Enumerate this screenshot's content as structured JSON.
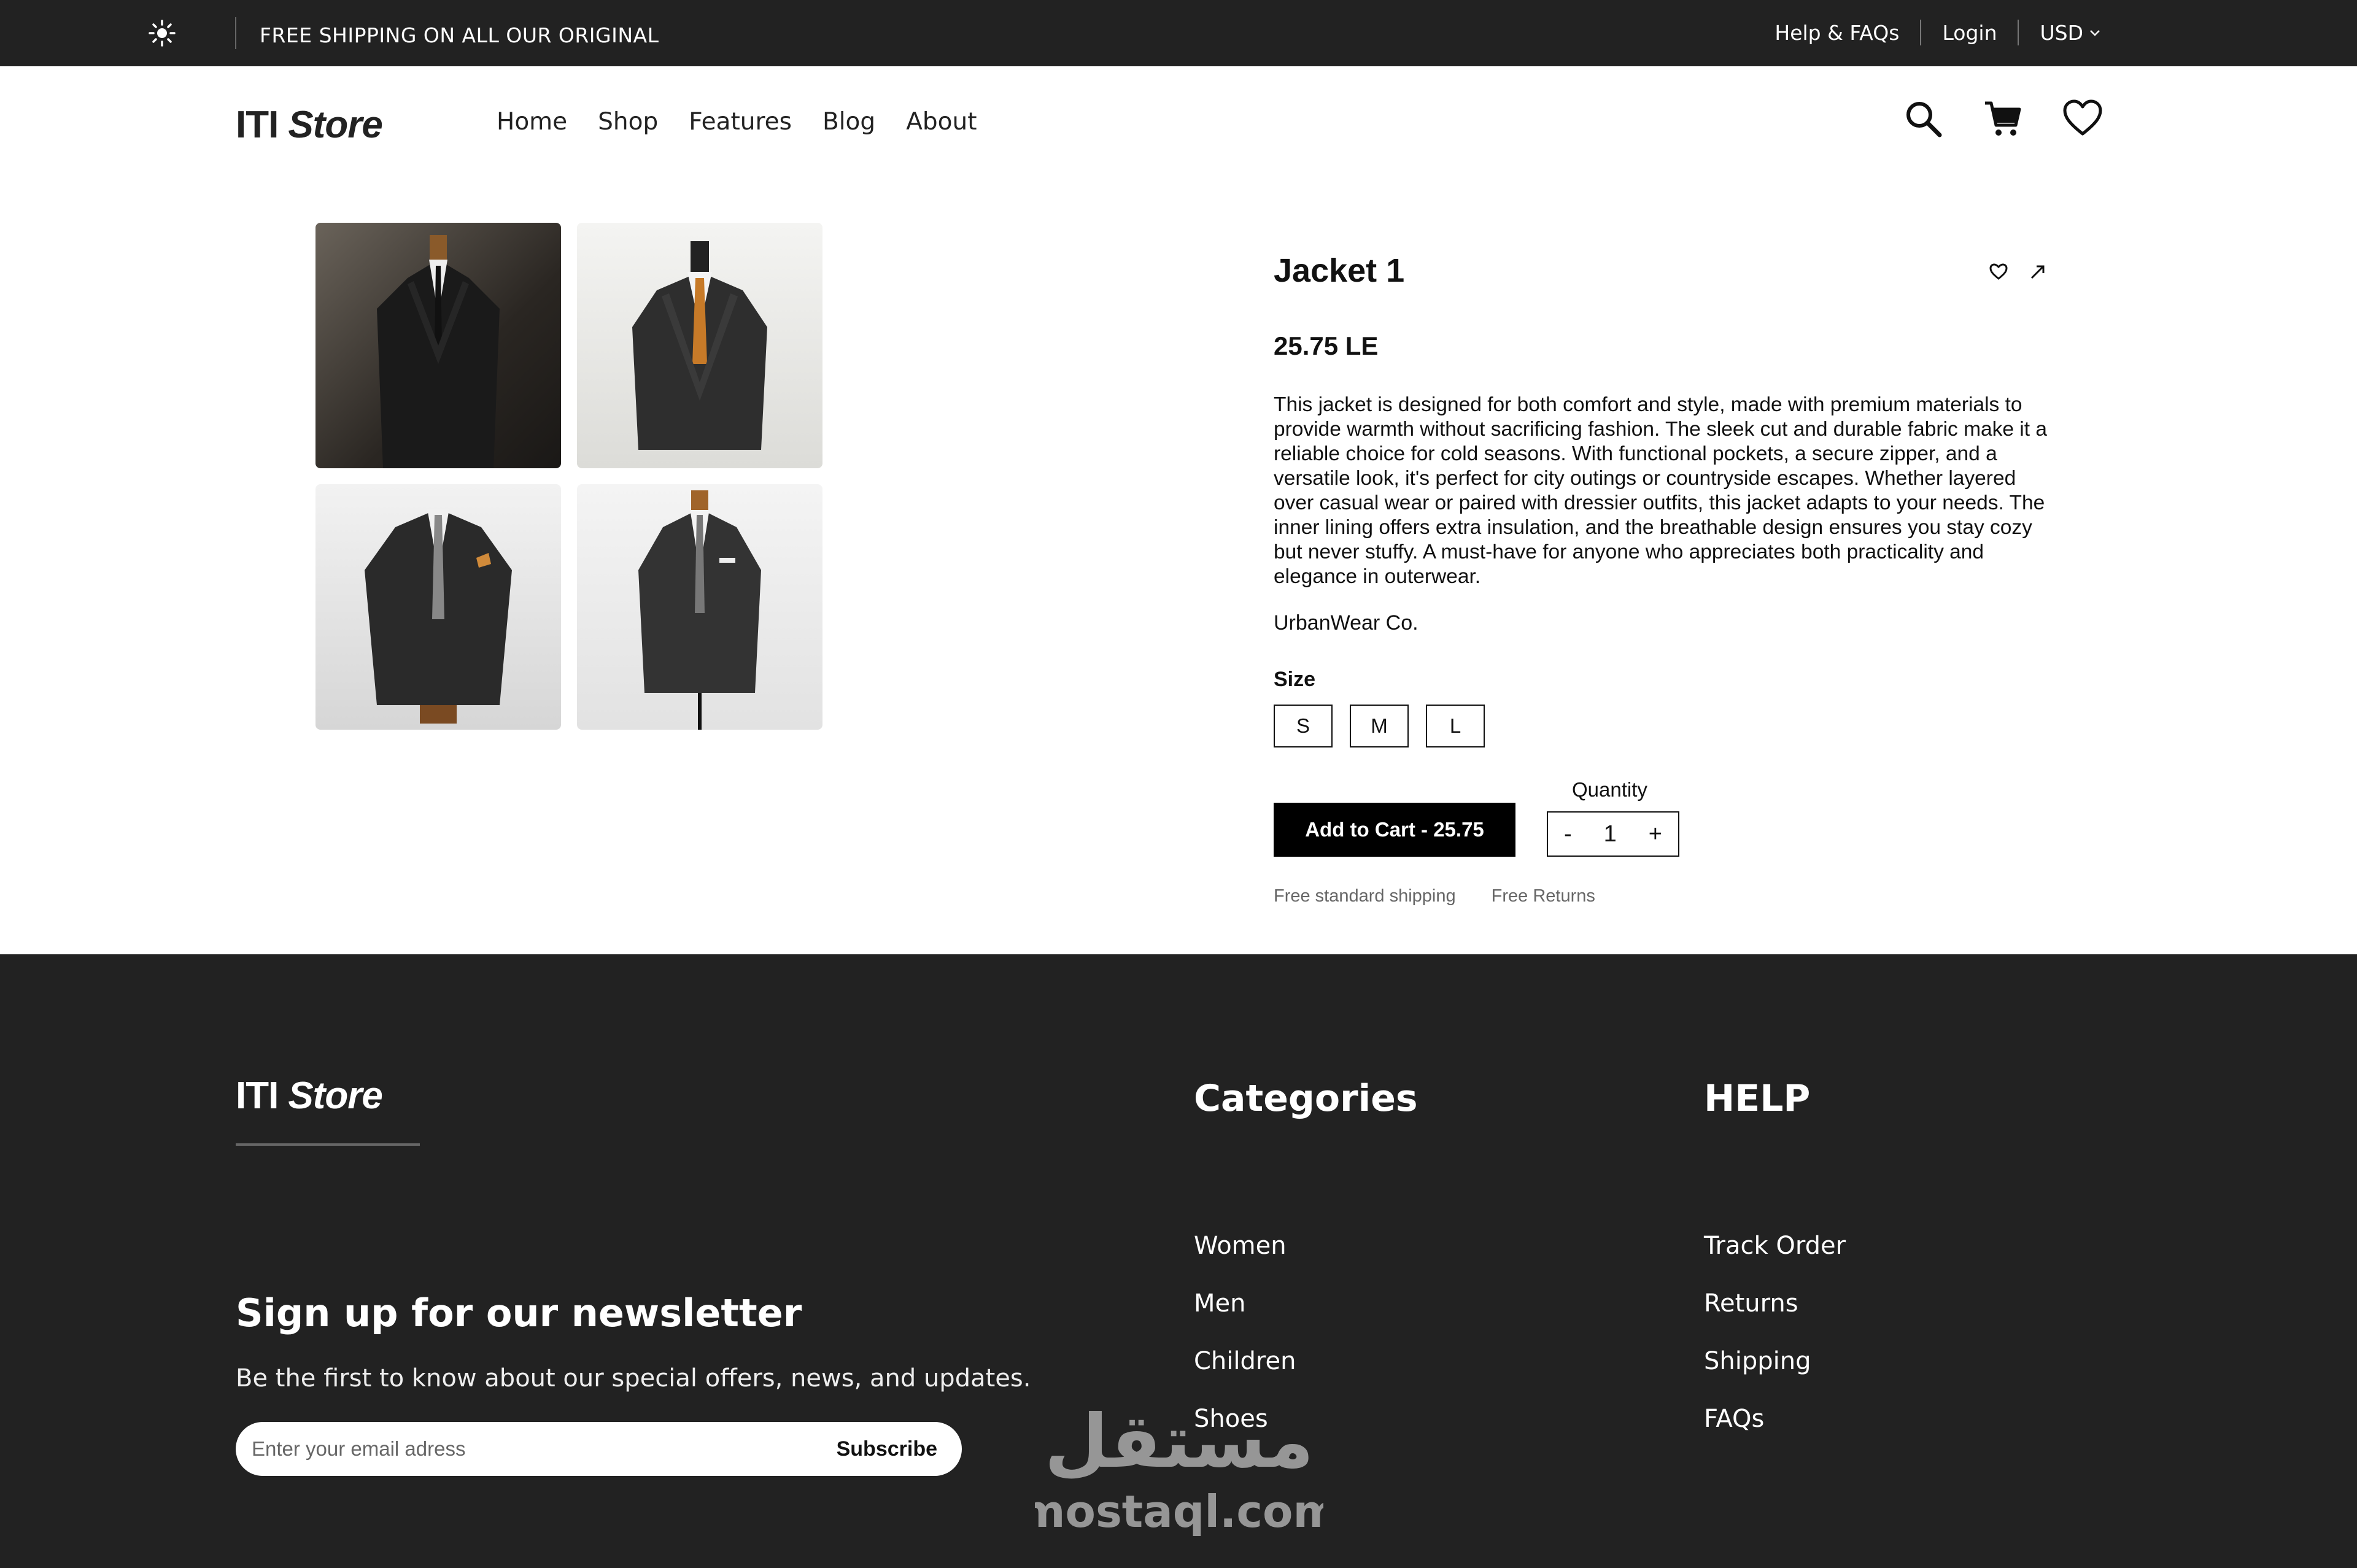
{
  "topbar": {
    "promo": "FREE SHIPPING ON ALL OUR ORIGINAL",
    "help": "Help & FAQs",
    "login": "Login",
    "currency": "USD"
  },
  "nav": {
    "logo_a": "ITI",
    "logo_b": "Store",
    "menu": [
      "Home",
      "Shop",
      "Features",
      "Blog",
      "About"
    ]
  },
  "product": {
    "title": "Jacket 1",
    "price": "25.75 LE",
    "description": "This jacket is designed for both comfort and style, made with premium materials to provide warmth without sacrificing fashion. The sleek cut and durable fabric make it a reliable choice for cold seasons. With functional pockets, a secure zipper, and a versatile look, it's perfect for city outings or countryside escapes. Whether layered over casual wear or paired with dressier outfits, this jacket adapts to your needs. The inner lining offers extra insulation, and the breathable design ensures you stay cozy but never stuffy. A must-have for anyone who appreciates both practicality and elegance in outerwear.",
    "brand": "UrbanWear Co.",
    "size_label": "Size",
    "sizes": [
      "S",
      "M",
      "L"
    ],
    "quantity_label": "Quantity",
    "quantity": "1",
    "minus": "-",
    "plus": "+",
    "add_to_cart": "Add to Cart - 25.75",
    "note_shipping": "Free standard shipping",
    "note_returns": "Free Returns"
  },
  "footer": {
    "logo_a": "ITI",
    "logo_b": "Store",
    "categories_heading": "Categories",
    "categories": [
      "Women",
      "Men",
      "Children",
      "Shoes"
    ],
    "help_heading": "HELP",
    "help": [
      "Track Order",
      "Returns",
      "Shipping",
      "FAQs"
    ],
    "newsletter_heading": "Sign up for our newsletter",
    "newsletter_text": "Be the first to know about our special offers, news, and updates.",
    "email_placeholder": "Enter your email adress",
    "subscribe": "Subscribe"
  },
  "watermark": {
    "arabic": "مستقل",
    "latin": "mostaql.com"
  },
  "icons": {
    "theme": "sun-icon",
    "search": "search-icon",
    "cart": "cart-icon",
    "wishlist": "heart-icon",
    "share": "arrow-icon"
  },
  "colors": {
    "dark": "#222222",
    "accent": "#000000",
    "muted": "#666666"
  }
}
